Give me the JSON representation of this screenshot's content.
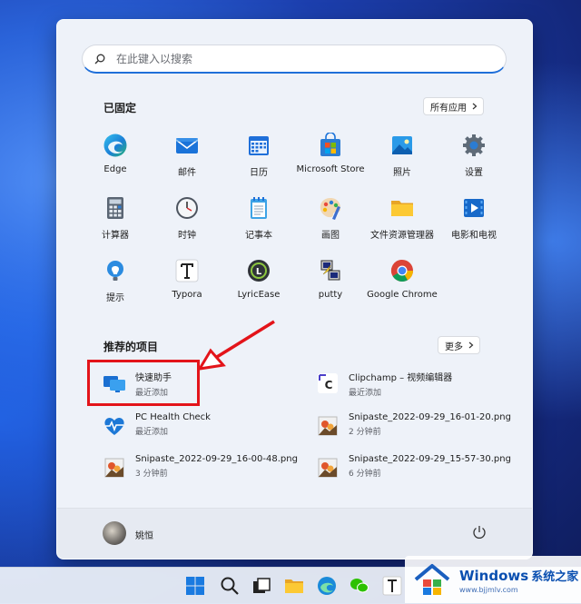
{
  "search": {
    "placeholder": "在此键入以搜索"
  },
  "pinned": {
    "title": "已固定",
    "all_apps_label": "所有应用",
    "apps": [
      {
        "label": "Edge",
        "icon": "edge-icon"
      },
      {
        "label": "邮件",
        "icon": "mail-icon"
      },
      {
        "label": "日历",
        "icon": "calendar-icon"
      },
      {
        "label": "Microsoft Store",
        "icon": "store-icon"
      },
      {
        "label": "照片",
        "icon": "photos-icon"
      },
      {
        "label": "设置",
        "icon": "settings-icon"
      },
      {
        "label": "计算器",
        "icon": "calculator-icon"
      },
      {
        "label": "时钟",
        "icon": "clock-icon"
      },
      {
        "label": "记事本",
        "icon": "notepad-icon"
      },
      {
        "label": "画图",
        "icon": "paint-icon"
      },
      {
        "label": "文件资源管理器",
        "icon": "file-explorer-icon"
      },
      {
        "label": "电影和电视",
        "icon": "movies-tv-icon"
      },
      {
        "label": "提示",
        "icon": "tips-icon"
      },
      {
        "label": "Typora",
        "icon": "typora-icon"
      },
      {
        "label": "LyricEase",
        "icon": "lyricease-icon"
      },
      {
        "label": "putty",
        "icon": "putty-icon"
      },
      {
        "label": "Google Chrome",
        "icon": "chrome-icon"
      }
    ]
  },
  "recommended": {
    "title": "推荐的项目",
    "more_label": "更多",
    "items": [
      {
        "name": "快速助手",
        "sub": "最近添加",
        "icon": "quick-assist-icon"
      },
      {
        "name": "Clipchamp – 视频编辑器",
        "sub": "最近添加",
        "icon": "clipchamp-icon"
      },
      {
        "name": "PC Health Check",
        "sub": "最近添加",
        "icon": "pc-health-icon"
      },
      {
        "name": "Snipaste_2022-09-29_16-01-20.png",
        "sub": "2 分钟前",
        "icon": "image-file-icon"
      },
      {
        "name": "Snipaste_2022-09-29_16-00-48.png",
        "sub": "3 分钟前",
        "icon": "image-file-icon"
      },
      {
        "name": "Snipaste_2022-09-29_15-57-30.png",
        "sub": "6 分钟前",
        "icon": "image-file-icon"
      }
    ]
  },
  "user": {
    "name": "姚恒"
  },
  "watermark": {
    "brand": "Windows",
    "brand_cn": "系统之家",
    "url": "www.bjjmlv.com"
  },
  "colors": {
    "accent": "#1f6fd9",
    "highlight": "#e3141a",
    "panel": "#eef2f9"
  }
}
